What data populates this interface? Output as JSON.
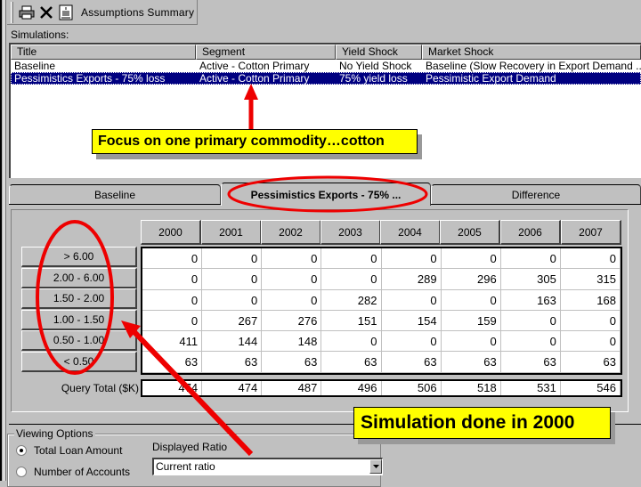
{
  "toolbar": {
    "icons": [
      "print-icon",
      "delete-icon",
      "report-icon"
    ],
    "label": "Assumptions Summary"
  },
  "simulations": {
    "label": "Simulations:",
    "columns": [
      "Title",
      "Segment",
      "Yield Shock",
      "Market Shock"
    ],
    "rows": [
      {
        "title": "Baseline",
        "segment": "Active - Cotton Primary",
        "yield_shock": "No Yield Shock",
        "market_shock": "Baseline (Slow Recovery in Export Demand ...",
        "selected": false
      },
      {
        "title": "Pessimistics Exports - 75% loss",
        "segment": "Active - Cotton Primary",
        "yield_shock": "75% yield loss",
        "market_shock": "Pessimistic Export Demand",
        "selected": true
      }
    ]
  },
  "annotations": {
    "callout_top": "Focus on one primary commodity…cotton",
    "callout_bottom": "Simulation done in 2000",
    "arrow_color": "#ee0000",
    "callout_color": "#ffff00"
  },
  "tabs": [
    {
      "label": "Baseline",
      "active": false
    },
    {
      "label": "Pessimistics Exports - 75% ...",
      "active": true
    },
    {
      "label": "Difference",
      "active": false
    }
  ],
  "grid": {
    "years": [
      "2000",
      "2001",
      "2002",
      "2003",
      "2004",
      "2005",
      "2006",
      "2007"
    ],
    "row_labels": [
      "> 6.00",
      "2.00 - 6.00",
      "1.50 - 2.00",
      "1.00 - 1.50",
      "0.50 - 1.00",
      "< 0.50"
    ],
    "values": [
      [
        "0",
        "0",
        "0",
        "0",
        "0",
        "0",
        "0",
        "0"
      ],
      [
        "0",
        "0",
        "0",
        "0",
        "289",
        "296",
        "305",
        "315"
      ],
      [
        "0",
        "0",
        "0",
        "282",
        "0",
        "0",
        "163",
        "168"
      ],
      [
        "0",
        "267",
        "276",
        "151",
        "154",
        "159",
        "0",
        "0"
      ],
      [
        "411",
        "144",
        "148",
        "0",
        "0",
        "0",
        "0",
        "0"
      ],
      [
        "63",
        "63",
        "63",
        "63",
        "63",
        "63",
        "63",
        "63"
      ]
    ],
    "total_label": "Query Total ($K)",
    "totals": [
      "474",
      "474",
      "487",
      "496",
      "506",
      "518",
      "531",
      "546"
    ]
  },
  "viewing_options": {
    "title": "Viewing Options",
    "radios": [
      {
        "label": "Total Loan Amount",
        "checked": true
      },
      {
        "label": "Number of Accounts",
        "checked": false
      }
    ],
    "ratio_label": "Displayed Ratio",
    "ratio_value": "Current ratio"
  }
}
